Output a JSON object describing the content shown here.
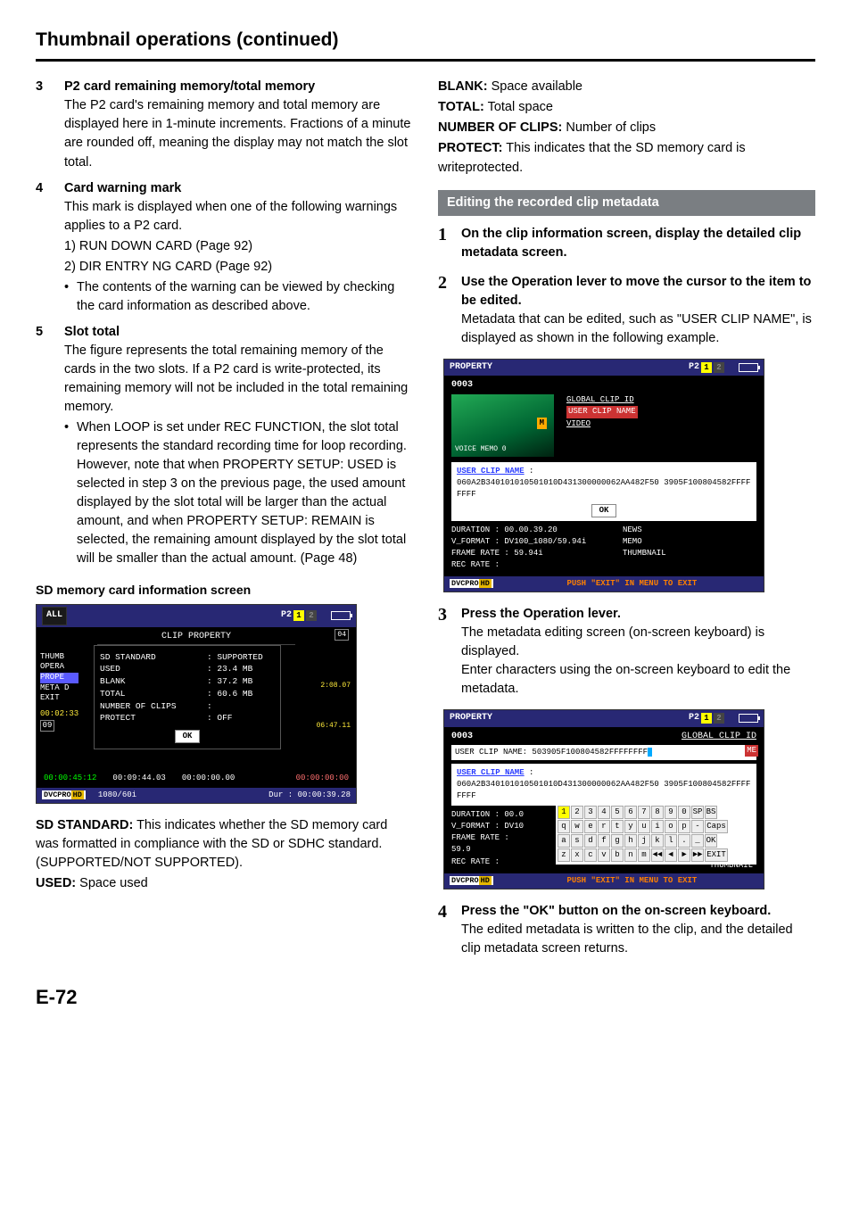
{
  "pageTitle": "Thumbnail operations (continued)",
  "left": {
    "items": [
      {
        "num": "3",
        "head": "P2 card remaining memory/total memory",
        "body": "The P2 card's remaining memory and total memory are displayed here in 1-minute increments. Fractions of a minute are rounded off, meaning the display may not match the slot total."
      },
      {
        "num": "4",
        "head": "Card warning mark",
        "body": "This mark is displayed when one of the following warnings applies to a P2 card.",
        "sub1": "1) RUN DOWN CARD (Page 92)",
        "sub2": "2) DIR ENTRY NG CARD (Page 92)",
        "bullet": "The contents of the warning can be viewed by checking the card information as described above."
      },
      {
        "num": "5",
        "head": "Slot total",
        "body": "The figure represents the total remaining memory of the cards in the two slots. If a P2 card is write-protected, its remaining memory will not be included in the total remaining memory.",
        "bullet": "When LOOP is set under REC FUNCTION, the slot total represents the standard recording time for loop recording. However, note that when PROPERTY SETUP: USED is selected in step 3 on the previous page, the used amount displayed by the slot total will be larger than the actual amount, and when PROPERTY SETUP: REMAIN is selected, the remaining amount displayed by the slot total will be smaller than the actual amount. (Page 48)"
      }
    ],
    "sdLabel": "SD memory card information screen",
    "sdScreen": {
      "topLeft": "ALL",
      "p2": "P2",
      "slot1": "1",
      "slot2": "2",
      "clipProp": "CLIP PROPERTY",
      "sideMenu": [
        "THUMB",
        "OPERA",
        "PROPE",
        "META D",
        "EXIT"
      ],
      "rows": [
        {
          "k": "SD STANDARD",
          "v": ": SUPPORTED"
        },
        {
          "k": "USED",
          "v": ": 23.4 MB"
        },
        {
          "k": "BLANK",
          "v": ": 37.2 MB"
        },
        {
          "k": "TOTAL",
          "v": ": 60.6 MB"
        },
        {
          "k": "NUMBER OF CLIPS",
          "v": ":"
        },
        {
          "k": "PROTECT",
          "v": ": OFF"
        }
      ],
      "ok": "OK",
      "cornerTop": "04",
      "time1": "2:08.07",
      "time2": "06:47.11",
      "leftSmall1": "00:02:33",
      "leftSmall2": "09",
      "bottomTimes": [
        "00:00:45:12",
        "00:09:44.03",
        "00:00:00.00"
      ],
      "footerRes": "1080/60i",
      "footerDur": "Dur : 00:00:39.28"
    },
    "defs": {
      "sdStandard": {
        "t": "SD STANDARD:",
        "d": "This indicates whether the SD memory card was formatted in compliance with the SD or SDHC standard. (SUPPORTED/NOT SUPPORTED)."
      },
      "used": {
        "t": "USED:",
        "d": "Space used"
      }
    }
  },
  "right": {
    "defs": {
      "blank": {
        "t": "BLANK:",
        "d": "Space available"
      },
      "total": {
        "t": "TOTAL:",
        "d": "Total space"
      },
      "clips": {
        "t": "NUMBER OF CLIPS:",
        "d": "Number of clips"
      },
      "protect": {
        "t": "PROTECT:",
        "d": "This indicates that the SD memory card is writeprotected."
      }
    },
    "sectionBar": "Editing the recorded clip metadata",
    "steps": [
      {
        "num": "1",
        "head": "On the clip information screen, display the detailed clip metadata screen."
      },
      {
        "num": "2",
        "head": "Use the Operation lever to move the cursor to the item to be edited.",
        "body": "Metadata that can be edited, such as \"USER CLIP NAME\", is displayed as shown in the following example."
      },
      {
        "num": "3",
        "head": "Press the Operation lever.",
        "body": "The metadata editing screen (on-screen keyboard) is displayed.",
        "body2": "Enter characters using the on-screen keyboard to edit the metadata."
      },
      {
        "num": "4",
        "head": "Press the \"OK\" button on the on-screen keyboard.",
        "body": "The edited metadata is written to the clip, and the detailed clip metadata screen returns."
      }
    ],
    "propScreen": {
      "title": "PROPERTY",
      "p2": "P2",
      "slot1": "1",
      "slot2": "2",
      "clipNo": "0003",
      "voiceMemo": "VOICE MEMO   0",
      "mBadge": "M",
      "rLinks": [
        "GLOBAL CLIP ID",
        "USER CLIP NAME",
        "VIDEO"
      ],
      "ucLabel": "USER CLIP NAME",
      "ucVal": "060A2B340101010501010D431300000062AA482F50 3905F100804582FFFFFFFF",
      "ok": "OK",
      "metaLeft": [
        "DURATION    : 00.00.39.20",
        "V_FORMAT    : DV100_1080/59.94i",
        "FRAME RATE : 59.94i",
        "REC RATE     :"
      ],
      "metaRight": [
        "NEWS",
        "MEMO",
        "THUMBNAIL"
      ],
      "pushExit": "PUSH \"EXIT\" IN MENU TO EXIT"
    },
    "kbScreen": {
      "title": "PROPERTY",
      "p2": "P2",
      "slot1": "1",
      "slot2": "2",
      "clipNo": "0003",
      "gc": "GLOBAL CLIP ID",
      "me": "ME",
      "field": "USER CLIP NAME: 503905F100804582FFFFFFFF",
      "ucLabel": "USER CLIP NAME",
      "ucVal": "060A2B340101010501010D431300000062AA482F50 3905F100804582FFFFFFFF",
      "rows": [
        [
          "1",
          "2",
          "3",
          "4",
          "5",
          "6",
          "7",
          "8",
          "9",
          "0",
          "SP",
          "BS"
        ],
        [
          "q",
          "w",
          "e",
          "r",
          "t",
          "y",
          "u",
          "i",
          "o",
          "p",
          "-",
          "Caps"
        ],
        [
          "a",
          "s",
          "d",
          "f",
          "g",
          "h",
          "j",
          "k",
          "l",
          ".",
          "_",
          "OK"
        ],
        [
          "z",
          "x",
          "c",
          "v",
          "b",
          "n",
          "m",
          "◄◄",
          "◄",
          "►",
          "►►",
          "EXIT"
        ]
      ],
      "metaLeft": [
        "DURATION    : 00.0",
        "V_FORMAT   : DV10",
        "FRAME RATE : 59.9",
        "REC RATE     :"
      ],
      "thumb": "THUMBNAIL",
      "pushExit": "PUSH \"EXIT\" IN MENU TO EXIT"
    }
  },
  "pageNum": "E-72",
  "dvcpro": "DVCPRO",
  "hd": "HD"
}
